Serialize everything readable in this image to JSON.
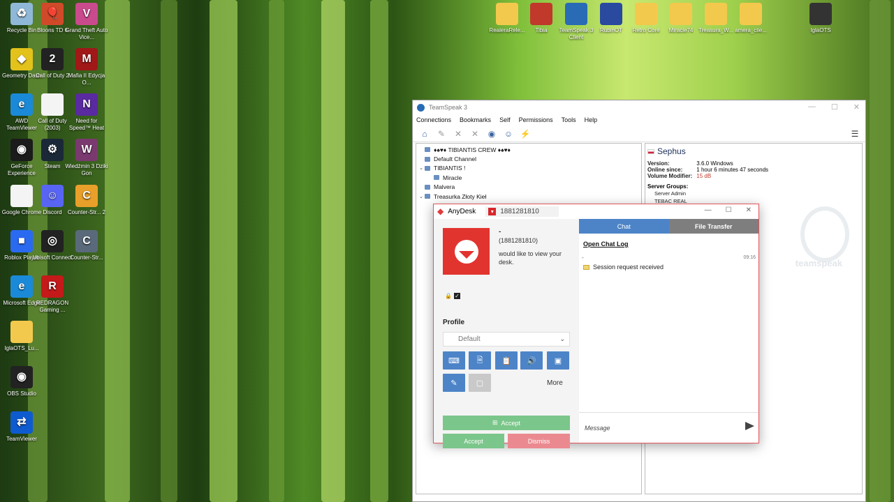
{
  "desktop": {
    "icons": [
      {
        "label": "Recycle Bin",
        "icon": "recycle-bin-icon",
        "color": "#8fb8d8",
        "glyph": "♻"
      },
      {
        "label": "Bloons TD 6",
        "icon": "bloons-icon",
        "color": "#d04a2a",
        "glyph": "🎈"
      },
      {
        "label": "Grand Theft Auto Vice...",
        "icon": "gta-icon",
        "color": "#c94b8d",
        "glyph": "V"
      },
      {
        "label": "Geometry Dash",
        "icon": "geometry-dash-icon",
        "color": "#e3c21b",
        "glyph": "◆"
      },
      {
        "label": "Call of Duty 2",
        "icon": "cod2-icon",
        "color": "#222222",
        "glyph": "2"
      },
      {
        "label": "Mafia II Edycja O...",
        "icon": "mafia-icon",
        "color": "#a01818",
        "glyph": "M"
      },
      {
        "label": "AWD TeamViewer",
        "icon": "edge-icon",
        "color": "#1a8ad8",
        "glyph": "e"
      },
      {
        "label": "Call of Duty (2003)",
        "icon": "file-icon",
        "color": "#f4f4f4",
        "glyph": ""
      },
      {
        "label": "Need for Speed™ Heat",
        "icon": "nfs-icon",
        "color": "#5a2aa0",
        "glyph": "N"
      },
      {
        "label": "GeForce Experience",
        "icon": "geforce-icon",
        "color": "#1b1b1b",
        "glyph": "◉"
      },
      {
        "label": "Steam",
        "icon": "steam-icon",
        "color": "#1b2838",
        "glyph": "⚙"
      },
      {
        "label": "Wiedźmin 3 Dziki Gon",
        "icon": "witcher-icon",
        "color": "#7a3a70",
        "glyph": "W"
      },
      {
        "label": "Google Chrome",
        "icon": "file-icon",
        "color": "#f4f4f4",
        "glyph": ""
      },
      {
        "label": "Discord",
        "icon": "discord-icon",
        "color": "#5865f2",
        "glyph": "☺"
      },
      {
        "label": "Counter-Str... 2",
        "icon": "cs2-icon",
        "color": "#e8a02a",
        "glyph": "C"
      },
      {
        "label": "Roblox Player",
        "icon": "roblox-icon",
        "color": "#2a6af0",
        "glyph": "■"
      },
      {
        "label": "Ubisoft Connect",
        "icon": "ubisoft-icon",
        "color": "#222222",
        "glyph": "◎"
      },
      {
        "label": "Counter-Str...",
        "icon": "csgo-icon",
        "color": "#5a6a7a",
        "glyph": "C"
      },
      {
        "label": "Microsoft Edge",
        "icon": "edge-icon",
        "color": "#1a8ad8",
        "glyph": "e"
      },
      {
        "label": "REDRAGON Gaming ...",
        "icon": "redragon-icon",
        "color": "#c41a1a",
        "glyph": "R"
      },
      {
        "label": "IglaOTS_Lu...",
        "icon": "folder-icon",
        "color": "#f3c94d",
        "glyph": ""
      },
      {
        "label": "OBS Studio",
        "icon": "obs-icon",
        "color": "#222222",
        "glyph": "◉"
      },
      {
        "label": "TeamViewer",
        "icon": "teamviewer-icon",
        "color": "#0e5bd0",
        "glyph": "⇄"
      }
    ],
    "top_icons": [
      {
        "label": "RealeraRele...",
        "icon": "folder-icon",
        "color": "#f3c94d"
      },
      {
        "label": "Tibia",
        "icon": "tibia-icon",
        "color": "#c0392b"
      },
      {
        "label": "TeamSpeak 3 Client",
        "icon": "teamspeak-icon",
        "color": "#2a6bb5"
      },
      {
        "label": "RubinOT",
        "icon": "rubinot-icon",
        "color": "#2a4aa0"
      },
      {
        "label": "Retro Core",
        "icon": "folder-icon",
        "color": "#f3c94d"
      },
      {
        "label": "Miracle74",
        "icon": "folder-icon",
        "color": "#f3c94d"
      },
      {
        "label": "Treasura_W...",
        "icon": "folder-icon",
        "color": "#f3c94d"
      },
      {
        "label": "amera_clie...",
        "icon": "folder-icon",
        "color": "#f3c94d"
      },
      {
        "label": "IglaOTS",
        "icon": "iglaots-icon",
        "color": "#333333"
      }
    ]
  },
  "teamspeak": {
    "title": "TeamSpeak 3",
    "menu": [
      "Connections",
      "Bookmarks",
      "Self",
      "Permissions",
      "Tools",
      "Help"
    ],
    "tree": [
      {
        "label": "♦♠♥♦ TIBIANTIS CREW ♦♠♥♦",
        "level": 0,
        "arrow": false
      },
      {
        "label": "Default Channel",
        "level": 0,
        "arrow": false
      },
      {
        "label": "TIBIANTIS !",
        "level": 0,
        "arrow": true
      },
      {
        "label": "Miracle",
        "level": 1,
        "arrow": false
      },
      {
        "label": "Malvera",
        "level": 0,
        "arrow": false
      },
      {
        "label": "Treasurka Złoty Kieł",
        "level": 0,
        "arrow": true
      },
      {
        "label": "Sephus",
        "level": 1,
        "arrow": false
      }
    ],
    "client": {
      "name": "Sephus",
      "version_label": "Version:",
      "version": "3.6.0 Windows",
      "online_label": "Online since:",
      "online": "1 hour 6 minutes 47 seconds",
      "volume_label": "Volume Modifier:",
      "volume": "15 dB",
      "groups_label": "Server Groups:",
      "groups": [
        "Server Admin",
        "TEBAC REAL"
      ]
    },
    "watermark": "teamspeak"
  },
  "anydesk": {
    "app_name": "AnyDesk",
    "tab_address": "1881281810",
    "requester_name": "-",
    "requester_id": "(1881281810)",
    "request_message": "would like to view your desk.",
    "profile_label": "Profile",
    "profile_value": "Default",
    "more_label": "More",
    "accept_wide_label": "Accept",
    "accept_label": "Accept",
    "dismiss_label": "Dismiss",
    "tab_chat": "Chat",
    "tab_file_transfer": "File Transfer",
    "open_chat_log": "Open Chat Log",
    "chat_sender": "-",
    "chat_time": "09:16",
    "chat_event": "Session request received",
    "message_placeholder": "Message"
  }
}
